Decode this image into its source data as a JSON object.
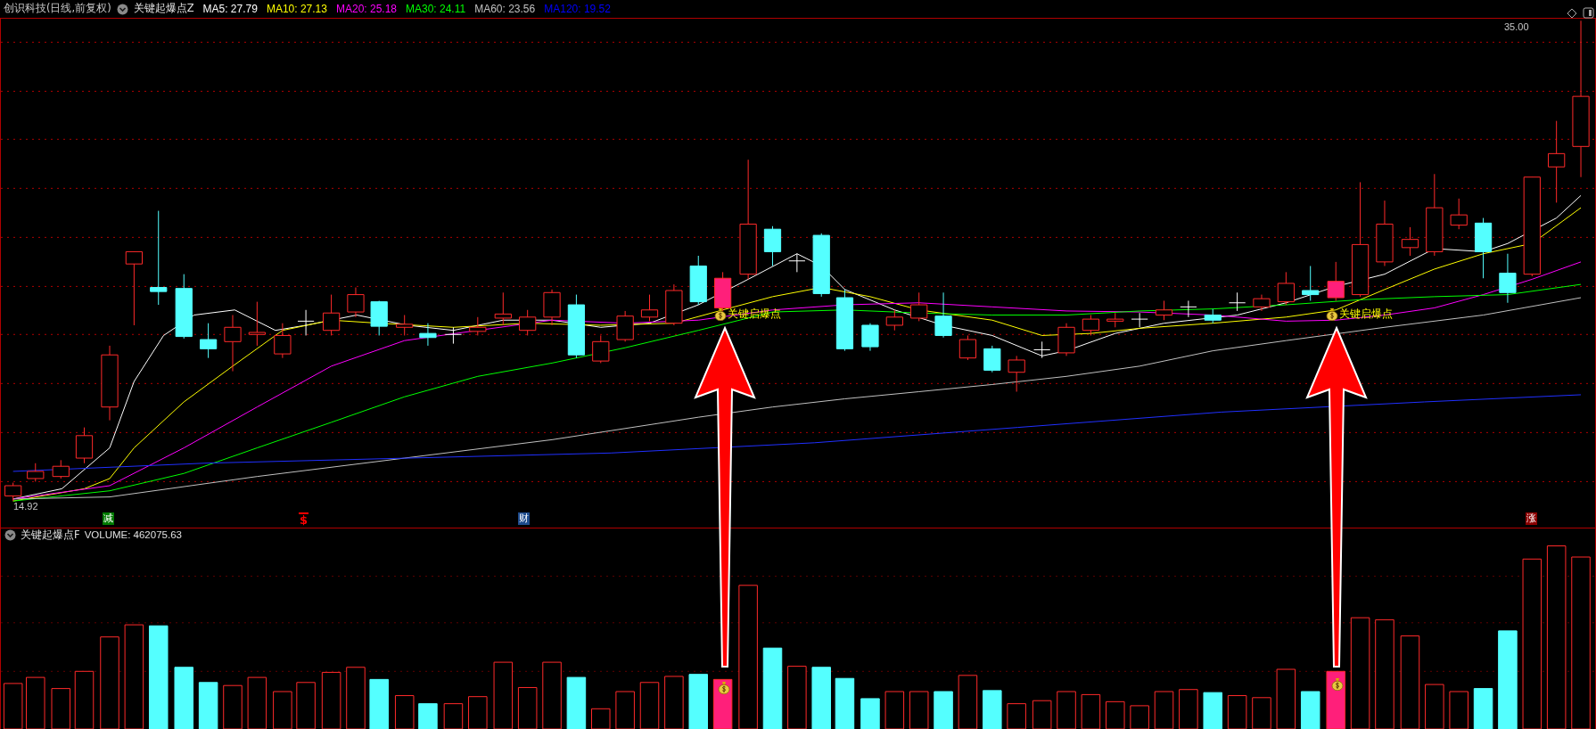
{
  "header": {
    "stock_name": "创识科技(日线,前复权)",
    "indicator": "关键起爆点Z",
    "ma_readings": [
      {
        "text": "MA5: 27.79",
        "color": "#ffffff"
      },
      {
        "text": "MA10: 27.13",
        "color": "#ffff00"
      },
      {
        "text": "MA20: 25.18",
        "color": "#ff00ff"
      },
      {
        "text": "MA30: 24.11",
        "color": "#00ff00"
      },
      {
        "text": "MA60: 23.56",
        "color": "#c0c0c0"
      },
      {
        "text": "MA120: 19.52",
        "color": "#0000ff"
      }
    ]
  },
  "price_chart": {
    "high_label": "35.00",
    "low_label": "14.92",
    "signals": [
      {
        "text": "关键启爆点"
      },
      {
        "text": "关键启爆点"
      }
    ],
    "event_markers": [
      {
        "text": "减",
        "kind": "box",
        "color": "#007a00"
      },
      {
        "text": "$",
        "kind": "plain",
        "color": "#ff0000"
      },
      {
        "text": "财",
        "kind": "box",
        "color": "#1e4b8c"
      },
      {
        "text": "涨",
        "kind": "box",
        "color": "#8b0000"
      }
    ]
  },
  "volume_panel": {
    "indicator": "关键起爆点F",
    "reading": "VOLUME: 462075.63"
  }
}
